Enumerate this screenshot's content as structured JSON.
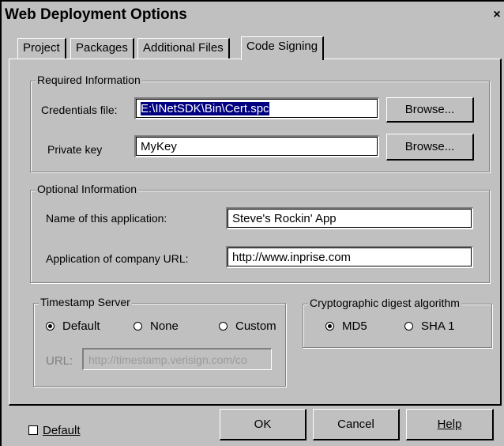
{
  "window": {
    "title": "Web Deployment Options",
    "close_glyph": "×"
  },
  "tabs": [
    {
      "label": "Project"
    },
    {
      "label": "Packages"
    },
    {
      "label": "Additional Files"
    },
    {
      "label": "Code Signing"
    }
  ],
  "required": {
    "legend": "Required Information",
    "credentials_label": "Credentials file:",
    "credentials_value": "E:\\INetSDK\\Bin\\Cert.spc",
    "private_key_label": "Private key",
    "private_key_value": "MyKey",
    "browse_label": "Browse..."
  },
  "optional": {
    "legend": "Optional Information",
    "app_name_label": "Name of this application:",
    "app_name_value": "Steve's Rockin' App",
    "url_label": "Application of company URL:",
    "url_value": "http://www.inprise.com"
  },
  "timestamp": {
    "legend": "Timestamp Server",
    "options": [
      "Default",
      "None",
      "Custom"
    ],
    "selected": "Default",
    "url_label": "URL:",
    "url_value": "http://timestamp.verisign.com/co"
  },
  "digest": {
    "legend": "Cryptographic digest algorithm",
    "options": [
      "MD5",
      "SHA 1"
    ],
    "selected": "MD5"
  },
  "footer": {
    "default_checkbox_label": "Default",
    "default_checked": false,
    "ok_label": "OK",
    "cancel_label": "Cancel",
    "help_label": "Help"
  }
}
